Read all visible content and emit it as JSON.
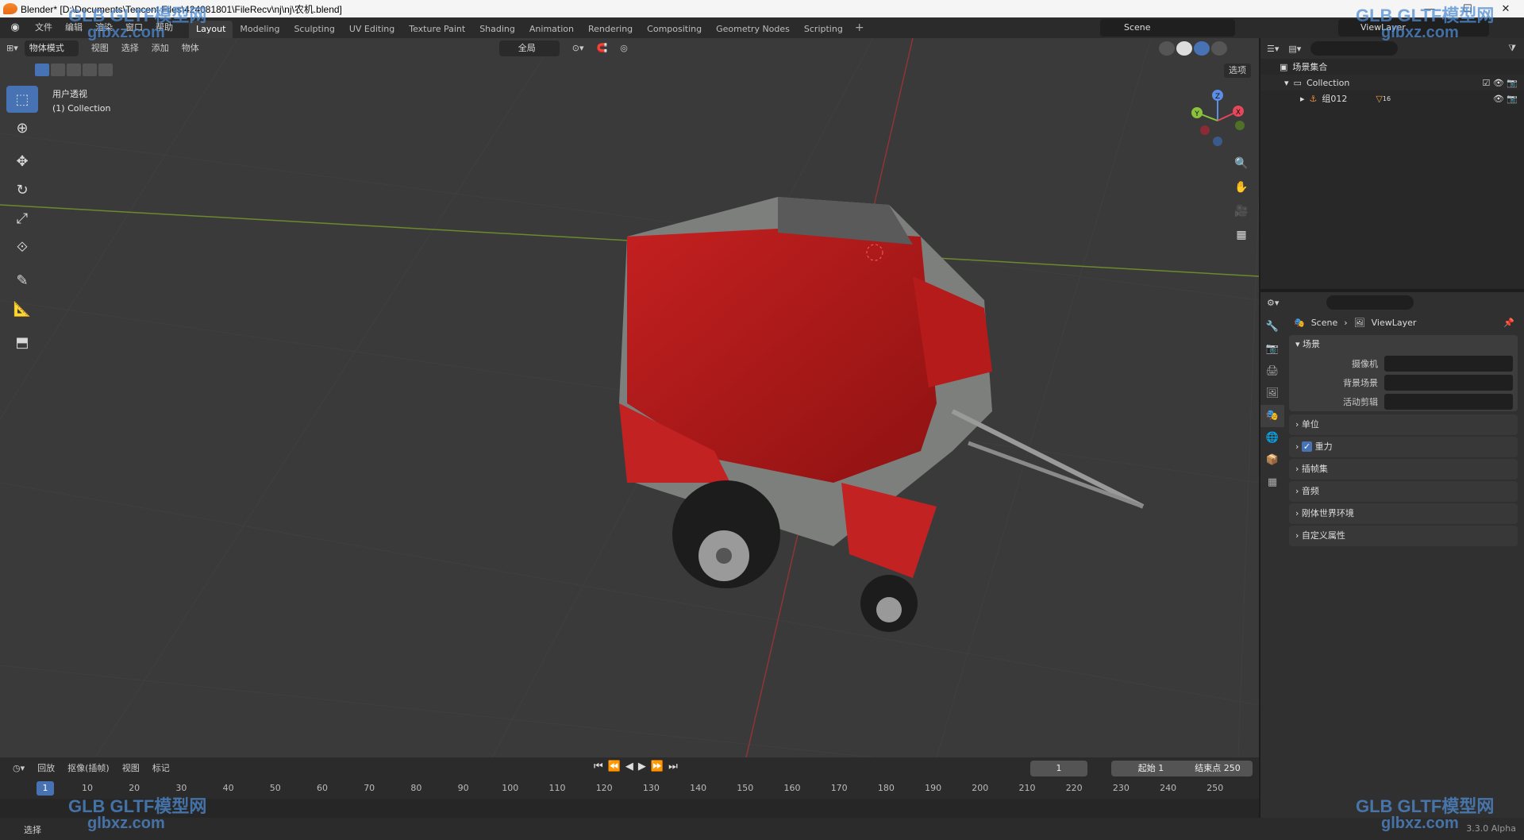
{
  "window": {
    "title": "Blender* [D:\\Documents\\Tencent Files\\424081801\\FileRecv\\nj\\nj\\农机.blend]",
    "minimize": "—",
    "maximize": "☐",
    "close": "✕"
  },
  "menu": {
    "items": [
      "文件",
      "编辑",
      "渲染",
      "窗口",
      "帮助"
    ],
    "workspaces": [
      "Layout",
      "Modeling",
      "Sculpting",
      "UV Editing",
      "Texture Paint",
      "Shading",
      "Animation",
      "Rendering",
      "Compositing",
      "Geometry Nodes",
      "Scripting"
    ],
    "active_workspace": "Layout",
    "add": "+",
    "scene": "Scene",
    "view_layer": "ViewLayer"
  },
  "viewport": {
    "mode": "物体模式",
    "menus": [
      "视图",
      "选择",
      "添加",
      "物体"
    ],
    "orientation": "全局",
    "options": "选项",
    "view_name": "用户透视",
    "collection_info": "(1) Collection",
    "gizmo_axes": {
      "x": "X",
      "y": "Y",
      "z": "Z"
    },
    "colors": {
      "background": "#3a3a3a",
      "grid": "#4a4a4a",
      "x_axis": "#8a3a3a",
      "y_axis": "#6a8a2a",
      "model_red": "#b01818"
    }
  },
  "tools": [
    "select-box",
    "cursor",
    "move",
    "rotate",
    "scale",
    "transform",
    "annotate",
    "measure",
    "add-cube"
  ],
  "outliner": {
    "root": "场景集合",
    "collection": "Collection",
    "object": "组012",
    "object_badge": "16"
  },
  "properties": {
    "search_placeholder": "",
    "crumb_scene": "Scene",
    "crumb_layer": "ViewLayer",
    "scene_panel": "场景",
    "fields": [
      {
        "label": "摄像机"
      },
      {
        "label": "背景场景"
      },
      {
        "label": "活动剪辑"
      }
    ],
    "sections": [
      "单位",
      "重力",
      "插帧集",
      "音频",
      "刚体世界环境",
      "自定义属性"
    ],
    "gravity_checked": true
  },
  "timeline": {
    "menus": [
      "回放",
      "抠像(插帧)",
      "视图",
      "标记"
    ],
    "current_frame": "1",
    "start_label": "起始",
    "start": "1",
    "end_label": "结束点",
    "end": "250",
    "ticks": [
      "1",
      "10",
      "20",
      "30",
      "40",
      "50",
      "60",
      "70",
      "80",
      "90",
      "100",
      "110",
      "120",
      "130",
      "140",
      "150",
      "160",
      "170",
      "180",
      "190",
      "200",
      "210",
      "220",
      "230",
      "240",
      "250"
    ]
  },
  "statusbar": {
    "left": "选择",
    "version": "3.3.0 Alpha"
  },
  "watermark": {
    "brand": "GLB GLTF模型网",
    "site": "glbxz.com"
  }
}
